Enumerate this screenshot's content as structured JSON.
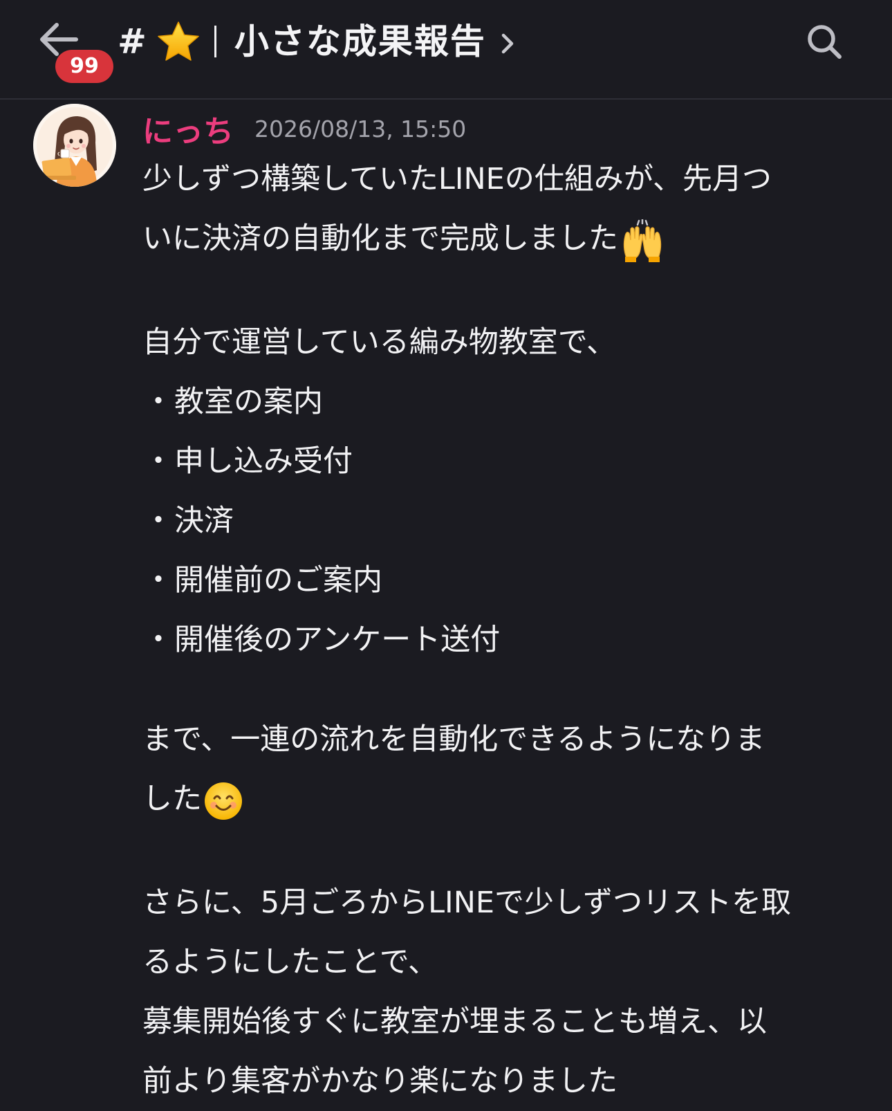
{
  "header": {
    "unread_count": "99",
    "channel_hash": "#",
    "channel_icon": "star-icon",
    "channel_name": "小さな成果報告",
    "back_icon": "arrow-left-icon",
    "chevron_icon": "chevron-right-icon",
    "search_icon": "search-icon"
  },
  "message": {
    "author": "にっち",
    "timestamp": "2026/08/13, 15:50",
    "avatar": "avatar-illustration",
    "lines": {
      "l1": "少しずつ構築していたLINEの仕組みが、先月つ",
      "l2": "いに決済の自動化まで完成しました",
      "l3": "自分で運営している編み物教室で、",
      "bullet": "・",
      "b1": "教室の案内",
      "b2": "申し込み受付",
      "b3": "決済",
      "b4": "開催前のご案内",
      "b5": "開催後のアンケート送付",
      "l4": "まで、一連の流れを自動化できるようになりま",
      "l5": "した",
      "l6": "さらに、5月ごろからLINEで少しずつリストを取",
      "l7": "るようにしたことで、",
      "l8": "募集開始後すぐに教室が埋まることも増え、以",
      "l9": "前より集客がかなり楽になりました"
    },
    "emojis": {
      "raised_hands": "raising-hands-emoji",
      "smile": "smiling-face-emoji"
    }
  },
  "colors": {
    "background": "#1b1b21",
    "username": "#ec3d7e",
    "badge": "#d8343b",
    "timestamp": "#a4a4ac"
  }
}
